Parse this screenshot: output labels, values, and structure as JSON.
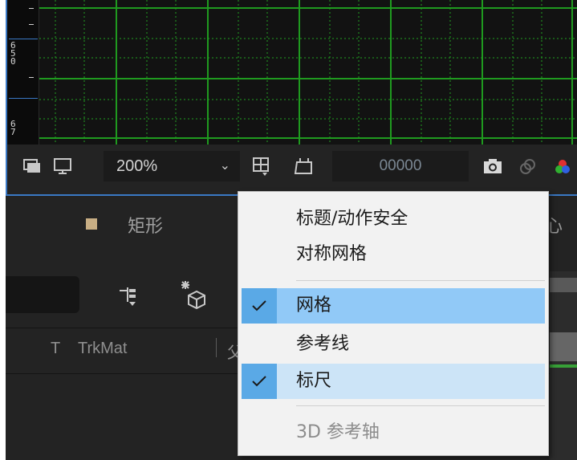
{
  "viewer": {
    "ruler_labels": [
      "6",
      "5",
      "0",
      "6",
      "7"
    ]
  },
  "toolbar": {
    "zoom_value": "200%",
    "timecode": "00000",
    "icons": [
      "region-of-interest-icon",
      "fast-previews-icon",
      "zoom-dropdown-icon",
      "grid-guide-icon",
      "mask-shape-icon",
      "snapshot-camera-icon",
      "show-snapshot-icon",
      "color-channel-icon"
    ]
  },
  "timeline": {
    "layer_name": "矩形",
    "layer_swatch_color": "#c8ae84",
    "right_clipped_text": "心",
    "column_t": "T",
    "column_trkmat": "TrkMat",
    "column_partial": "父"
  },
  "menu": {
    "items": [
      {
        "label": "标题/动作安全",
        "checked": false
      },
      {
        "label": "对称网格",
        "checked": false
      },
      {
        "label": "网格",
        "checked": true,
        "highlighted": true
      },
      {
        "label": "参考线",
        "checked": false
      },
      {
        "label": "标尺",
        "checked": true
      },
      {
        "label": "3D 参考轴",
        "checked": false,
        "disabled": true
      }
    ]
  },
  "colors": {
    "grid_line": "#22a022",
    "accent_blue": "#3a78c4",
    "menu_highlight": "#91c9f7",
    "menu_check_bg": "#5aa9e6"
  }
}
